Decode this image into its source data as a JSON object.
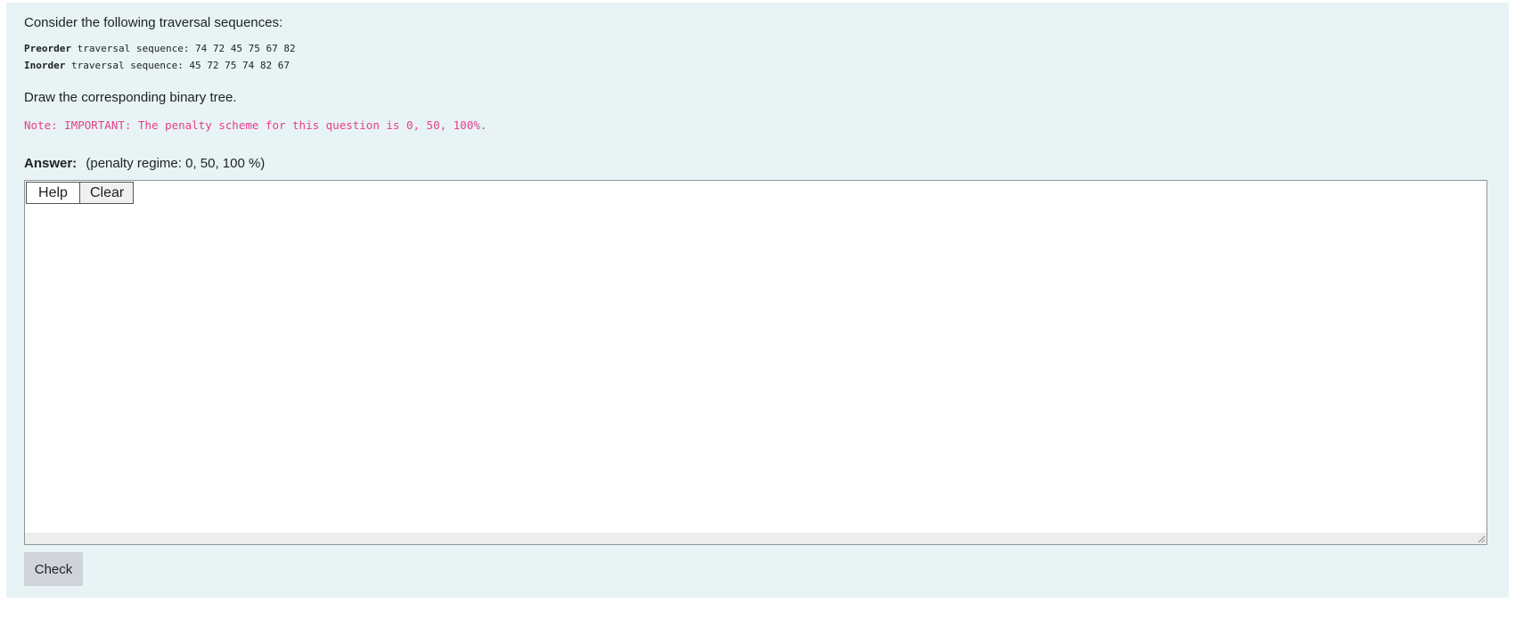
{
  "question": {
    "intro": "Consider the following traversal sequences:",
    "preorder": {
      "label": "Preorder",
      "text": " traversal sequence: 74 72 45 75 67 82"
    },
    "inorder": {
      "label": "Inorder",
      "text": " traversal sequence: 45 72 75 74 82 67"
    },
    "instruction": "Draw the corresponding binary tree.",
    "note": "Note: IMPORTANT: The penalty scheme for this question is 0, 50, 100%."
  },
  "answer": {
    "label": "Answer:",
    "penalty_text": "(penalty regime: 0, 50, 100 %)"
  },
  "toolbar": {
    "help_label": "Help",
    "clear_label": "Clear"
  },
  "check_label": "Check",
  "colors": {
    "panel_background": "#e7f3f5",
    "note_text": "#e83e8c",
    "check_button": "#ced4da"
  }
}
